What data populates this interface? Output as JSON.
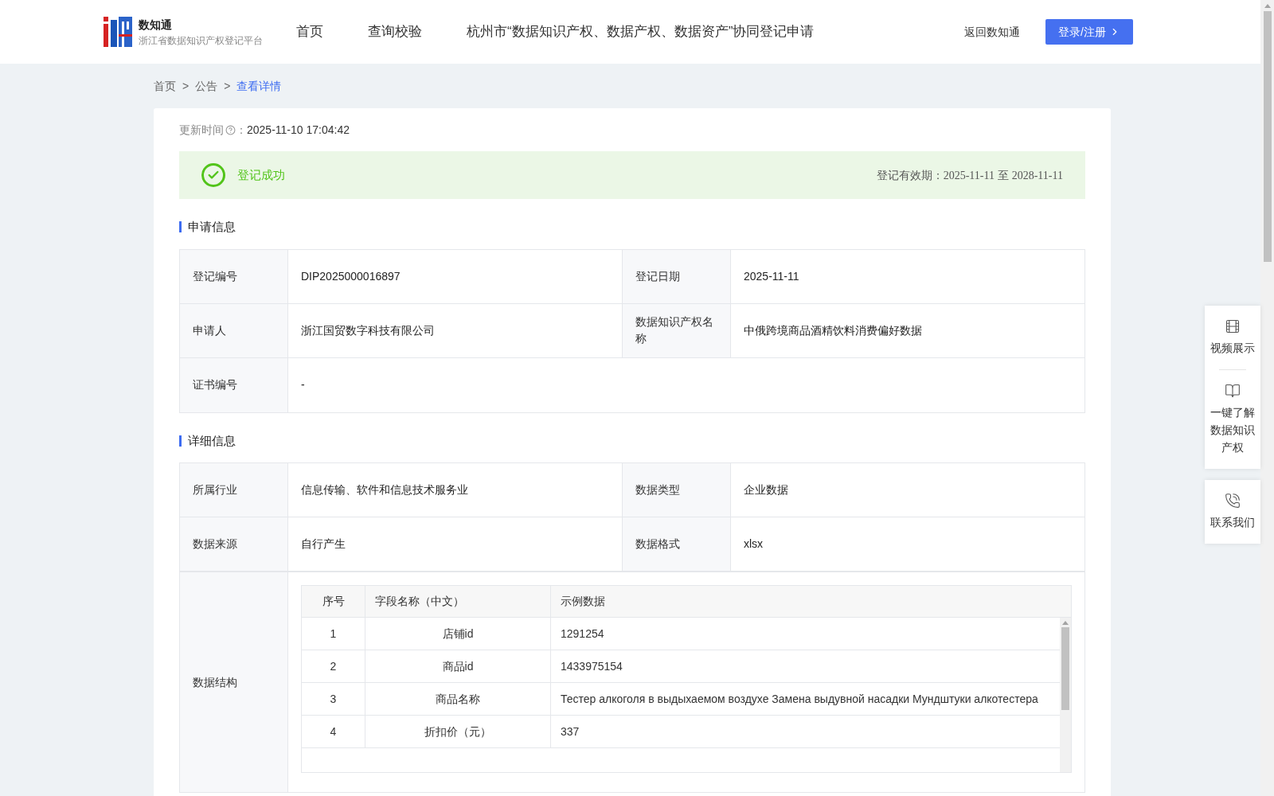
{
  "header": {
    "brand": "数知通",
    "subtitle": "浙江省数据知识产权登记平台",
    "nav": [
      {
        "label": "首页",
        "selected": false
      },
      {
        "label": "查询校验",
        "selected": false
      },
      {
        "label": "杭州市“数据知识产权、数据产权、数据资产”协同登记申请",
        "selected": false
      }
    ],
    "back_link": "返回数知通",
    "login_button": "登录/注册"
  },
  "breadcrumb": [
    {
      "label": "首页",
      "selected": false
    },
    {
      "label": "公告",
      "selected": false
    },
    {
      "label": "查看详情",
      "selected": true
    }
  ],
  "breadcrumb_separator": ">",
  "updated": {
    "label": "更新时间",
    "colon": "：",
    "value": "2025-11-10 17:04:42"
  },
  "status": {
    "text": "登记成功",
    "validity_label": "登记有效期：",
    "start": "2025-11-11",
    "to": "至",
    "end": "2028-11-11"
  },
  "application": {
    "title": "申请信息",
    "rows": [
      [
        {
          "label": "登记编号",
          "value": "DIP2025000016897"
        },
        {
          "label": "登记日期",
          "value": "2025-11-11"
        }
      ],
      [
        {
          "label": "申请人",
          "value": "浙江国贸数字科技有限公司"
        },
        {
          "label": "数据知识产权名称",
          "value": "中俄跨境商品酒精饮料消费偏好数据"
        }
      ],
      [
        {
          "label": "证书编号",
          "value": "-"
        }
      ]
    ]
  },
  "details": {
    "title": "详细信息",
    "rows": [
      [
        {
          "label": "所属行业",
          "value": "信息传输、软件和信息技术服务业"
        },
        {
          "label": "数据类型",
          "value": "企业数据"
        }
      ],
      [
        {
          "label": "数据来源",
          "value": "自行产生"
        },
        {
          "label": "数据格式",
          "value": "xlsx"
        }
      ]
    ],
    "structure_label": "数据结构",
    "structure": {
      "columns": [
        "序号",
        "字段名称（中文）",
        "示例数据"
      ],
      "rows": [
        [
          "1",
          "店铺id",
          "1291254"
        ],
        [
          "2",
          "商品id",
          "1433975154"
        ],
        [
          "3",
          "商品名称",
          "Тестер алкоголя в выдыхаемом воздухе Замена выдувной насадки Мундштуки алкотестера"
        ],
        [
          "4",
          "折扣价（元）",
          "337"
        ]
      ]
    }
  },
  "side_panel": [
    {
      "kind": "video",
      "label": "视频展示"
    },
    {
      "kind": "book",
      "label": "一键了解数据知识产权"
    },
    {
      "kind": "phone",
      "label": "联系我们"
    }
  ]
}
